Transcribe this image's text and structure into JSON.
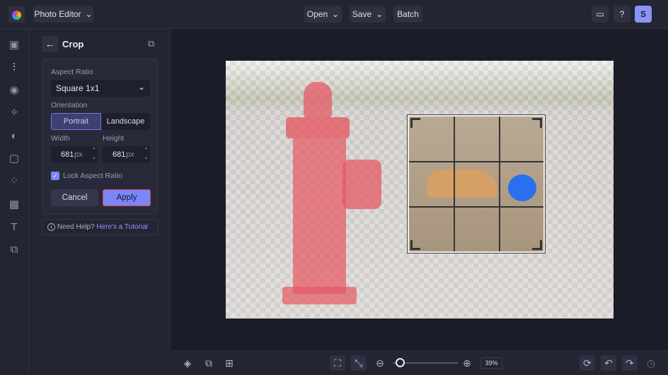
{
  "header": {
    "app_menu": "Photo Editor",
    "open": "Open",
    "save": "Save",
    "batch": "Batch",
    "avatar": "S"
  },
  "panel": {
    "title": "Crop",
    "aspect_label": "Aspect Ratio",
    "aspect_value": "Square 1x1",
    "orientation_label": "Orientation",
    "portrait": "Portrait",
    "landscape": "Landscape",
    "width_label": "Width",
    "height_label": "Height",
    "width_value": "681",
    "height_value": "681",
    "unit": "px",
    "lock_label": "Lock Aspect Ratio",
    "lock_checked": true,
    "cancel": "Cancel",
    "apply": "Apply",
    "help_text": "Need Help?",
    "help_link": "Here's a Tutorial"
  },
  "zoom": {
    "value": "39%",
    "fraction": 0.05
  },
  "colors": {
    "accent": "#7b86f8",
    "bg": "#232533"
  }
}
